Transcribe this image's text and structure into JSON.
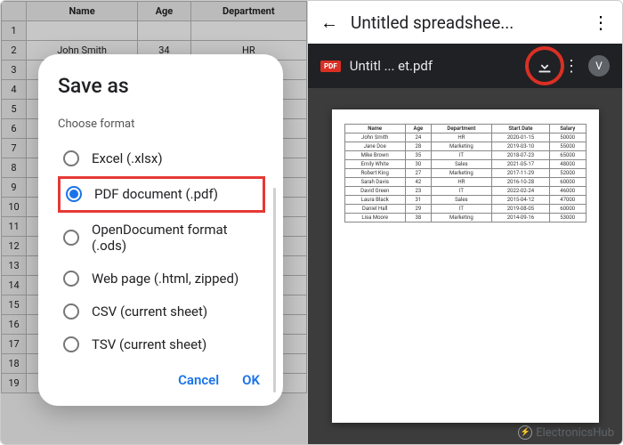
{
  "left": {
    "sheet_headers": {
      "name": "Name",
      "age": "Age",
      "dept": "Department"
    },
    "sheet_rows": [
      {
        "n": "1",
        "name": "",
        "age": "",
        "dept": ""
      },
      {
        "n": "2",
        "name": "John Smith",
        "age": "34",
        "dept": "HR"
      }
    ],
    "dialog": {
      "title": "Save as",
      "subhead": "Choose format",
      "formats": {
        "xlsx": "Excel (.xlsx)",
        "pdf": "PDF document (.pdf)",
        "ods": "OpenDocument format (.ods)",
        "html": "Web page (.html, zipped)",
        "csv": "CSV (current sheet)",
        "tsv": "TSV (current sheet)"
      },
      "cancel": "Cancel",
      "ok": "OK"
    }
  },
  "right": {
    "title": "Untitled spreadshee...",
    "pdf_name": "Untitl ... et.pdf",
    "avatar": "V",
    "table": {
      "headers": [
        "Name",
        "Age",
        "Department",
        "Start Date",
        "Salary"
      ],
      "rows": [
        [
          "John Smith",
          "24",
          "HR",
          "2020-01-15",
          "50000"
        ],
        [
          "Jane Doe",
          "28",
          "Marketing",
          "2019-03-10",
          "55000"
        ],
        [
          "Mike Brown",
          "35",
          "IT",
          "2018-07-23",
          "65000"
        ],
        [
          "Emily White",
          "30",
          "Sales",
          "2021-05-17",
          "48000"
        ],
        [
          "Robert King",
          "27",
          "Marketing",
          "2017-11-29",
          "52000"
        ],
        [
          "Sarah Davis",
          "42",
          "HR",
          "2016-10-28",
          "60000"
        ],
        [
          "David Green",
          "23",
          "IT",
          "2022-02-24",
          "46000"
        ],
        [
          "Laura Black",
          "31",
          "Sales",
          "2015-04-12",
          "47000"
        ],
        [
          "Daniel Hall",
          "29",
          "IT",
          "2019-08-05",
          "60000"
        ],
        [
          "Lisa Moore",
          "38",
          "Marketing",
          "2014-09-16",
          "53000"
        ]
      ]
    }
  },
  "watermark": "ElectronicsHub"
}
